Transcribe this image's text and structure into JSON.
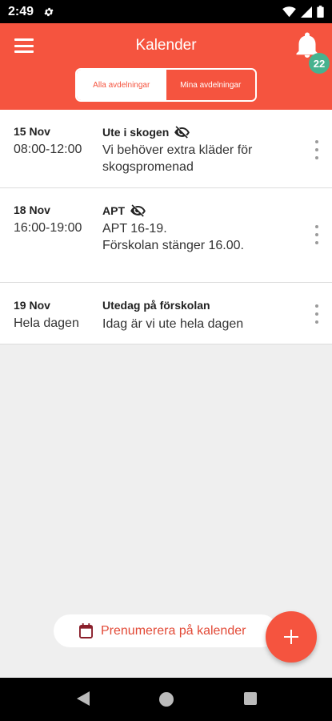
{
  "status_bar": {
    "time": "2:49",
    "icons": [
      "gear-icon",
      "wifi-icon",
      "signal-icon",
      "battery-icon"
    ]
  },
  "header": {
    "title": "Kalender",
    "notification_count": "22"
  },
  "segments": {
    "all": "Alla avdelningar",
    "mine": "Mina avdelningar",
    "selected": "mine"
  },
  "events": [
    {
      "date": "15 Nov",
      "time": "08:00-12:00",
      "title": "Ute i skogen",
      "hidden_icon": true,
      "description": "Vi behöver extra kläder för skogspromenad"
    },
    {
      "date": "18 Nov",
      "time": "16:00-19:00",
      "title": "APT",
      "hidden_icon": true,
      "description_lines": [
        "APT 16-19.",
        "Förskolan stänger 16.00."
      ]
    },
    {
      "date": "19 Nov",
      "time": "Hela dagen",
      "title": "Utedag på förskolan",
      "hidden_icon": false,
      "description": "Idag är vi ute hela dagen"
    }
  ],
  "subscribe": {
    "label": "Prenumerera på kalender"
  },
  "colors": {
    "primary": "#f5543f",
    "badge": "#47b28f",
    "background": "#efefef"
  }
}
